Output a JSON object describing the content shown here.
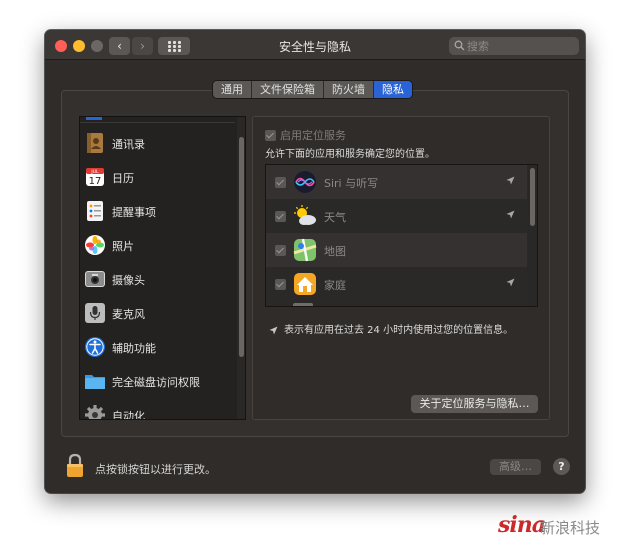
{
  "window": {
    "title": "安全性与隐私",
    "search_placeholder": "搜索",
    "nav_back": "‹",
    "nav_forward": "›"
  },
  "tabs": [
    {
      "label": "通用"
    },
    {
      "label": "文件保险箱"
    },
    {
      "label": "防火墙"
    },
    {
      "label": "隐私",
      "active": true
    }
  ],
  "sidebar": {
    "items": [
      {
        "label": "通讯录",
        "icon": "contacts-icon"
      },
      {
        "label": "日历",
        "icon": "calendar-icon",
        "month": "JUL",
        "day": "17"
      },
      {
        "label": "提醒事项",
        "icon": "reminders-icon"
      },
      {
        "label": "照片",
        "icon": "photos-icon"
      },
      {
        "label": "摄像头",
        "icon": "camera-icon"
      },
      {
        "label": "麦克风",
        "icon": "microphone-icon"
      },
      {
        "label": "辅助功能",
        "icon": "accessibility-icon"
      },
      {
        "label": "完全磁盘访问权限",
        "icon": "folder-icon"
      },
      {
        "label": "自动化",
        "icon": "gear-icon"
      }
    ]
  },
  "location": {
    "enable_label": "启用定位服务",
    "description": "允许下面的应用和服务确定您的位置。",
    "apps": [
      {
        "label": "Siri 与听写",
        "icon": "siri-icon",
        "recent": true
      },
      {
        "label": "天气",
        "icon": "weather-icon",
        "recent": true
      },
      {
        "label": "地图",
        "icon": "maps-icon",
        "recent": false
      },
      {
        "label": "家庭",
        "icon": "home-icon",
        "recent": true
      }
    ],
    "note": "表示有应用在过去 24 小时内使用过您的位置信息。",
    "about_button": "关于定位服务与隐私…"
  },
  "footer": {
    "lock_text": "点按锁按钮以进行更改。",
    "advanced_button": "高级…",
    "help_button": "?"
  },
  "watermark": {
    "logo": "sina",
    "text": "新浪科技"
  }
}
